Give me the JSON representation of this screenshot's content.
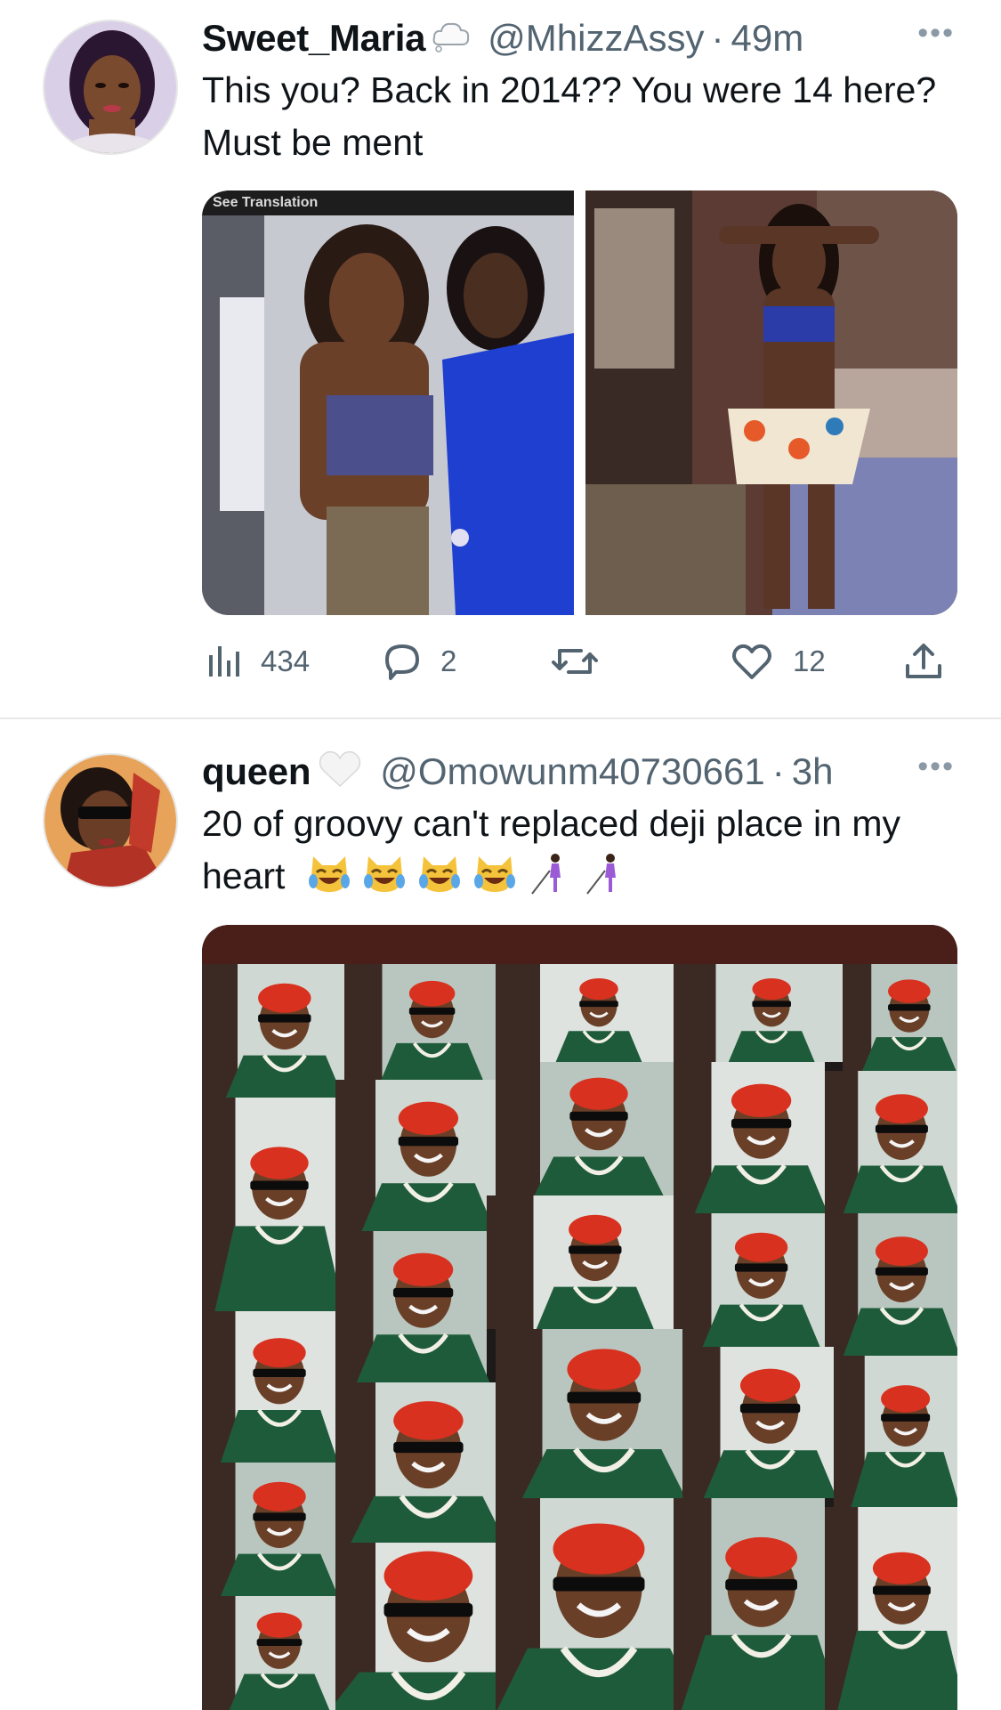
{
  "tweets": [
    {
      "display_name": "Sweet_Maria",
      "badge_icon": "cloud-icon",
      "handle": "@MhizzAssy",
      "separator": "·",
      "time": "49m",
      "text": "This you? Back in 2014?? You were 14 here? Must be ment",
      "media": {
        "overlay_text": "See Translation",
        "images": [
          "photo-left",
          "photo-right"
        ]
      },
      "stats": {
        "views": "434",
        "replies": "2",
        "retweets": "",
        "likes": "12"
      }
    },
    {
      "display_name": "queen",
      "badge_icon": "white-heart-icon",
      "handle": "@Omowunm40730661",
      "separator": "·",
      "time": "3h",
      "text": "20 of groovy can't replaced deji place in my heart",
      "emojis": [
        "cat-tears-of-joy-icon",
        "cat-tears-of-joy-icon",
        "cat-tears-of-joy-icon",
        "cat-tears-of-joy-icon",
        "person-with-cane-icon",
        "person-with-cane-icon"
      ],
      "media": {
        "images": [
          "collage-photo"
        ]
      }
    }
  ],
  "colors": {
    "text": "#0f1419",
    "secondary": "#536471",
    "divider": "#e7e9ea",
    "cap_red": "#d8311f"
  }
}
